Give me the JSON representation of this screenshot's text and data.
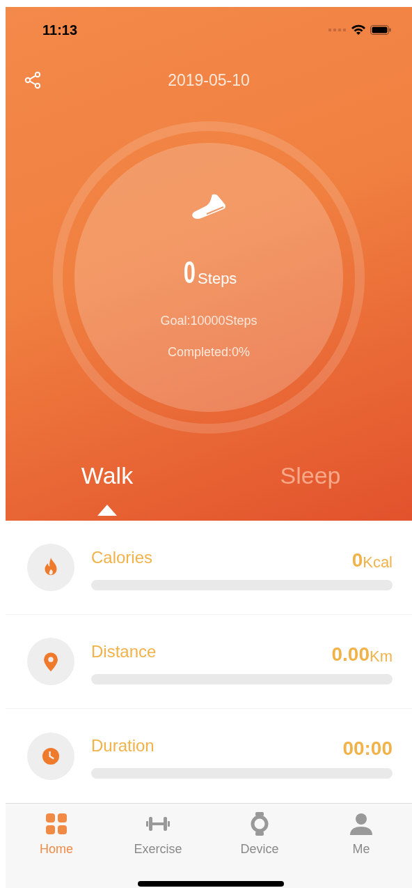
{
  "status_bar": {
    "time": "11:13"
  },
  "header": {
    "date": "2019-05-10"
  },
  "steps": {
    "value": "0",
    "unit": "Steps",
    "goal": "Goal:10000Steps",
    "completed": "Completed:0%"
  },
  "tabs": [
    {
      "label": "Walk",
      "selected": true
    },
    {
      "label": "Sleep",
      "selected": false
    }
  ],
  "metrics": [
    {
      "kind": "calories",
      "label": "Calories",
      "value": "0",
      "unit": "Kcal",
      "level": 0
    },
    {
      "kind": "distance",
      "label": "Distance",
      "value": "0.00",
      "unit": "Km",
      "level": 0
    },
    {
      "kind": "duration",
      "label": "Duration",
      "value": "00:00",
      "level": 0
    }
  ],
  "nav": [
    {
      "kind": "home",
      "label": "Home",
      "selected": true
    },
    {
      "kind": "exercise",
      "label": "Exercise",
      "selected": false
    },
    {
      "kind": "device",
      "label": "Device",
      "selected": false
    },
    {
      "kind": "me",
      "label": "Me",
      "selected": false
    }
  ]
}
